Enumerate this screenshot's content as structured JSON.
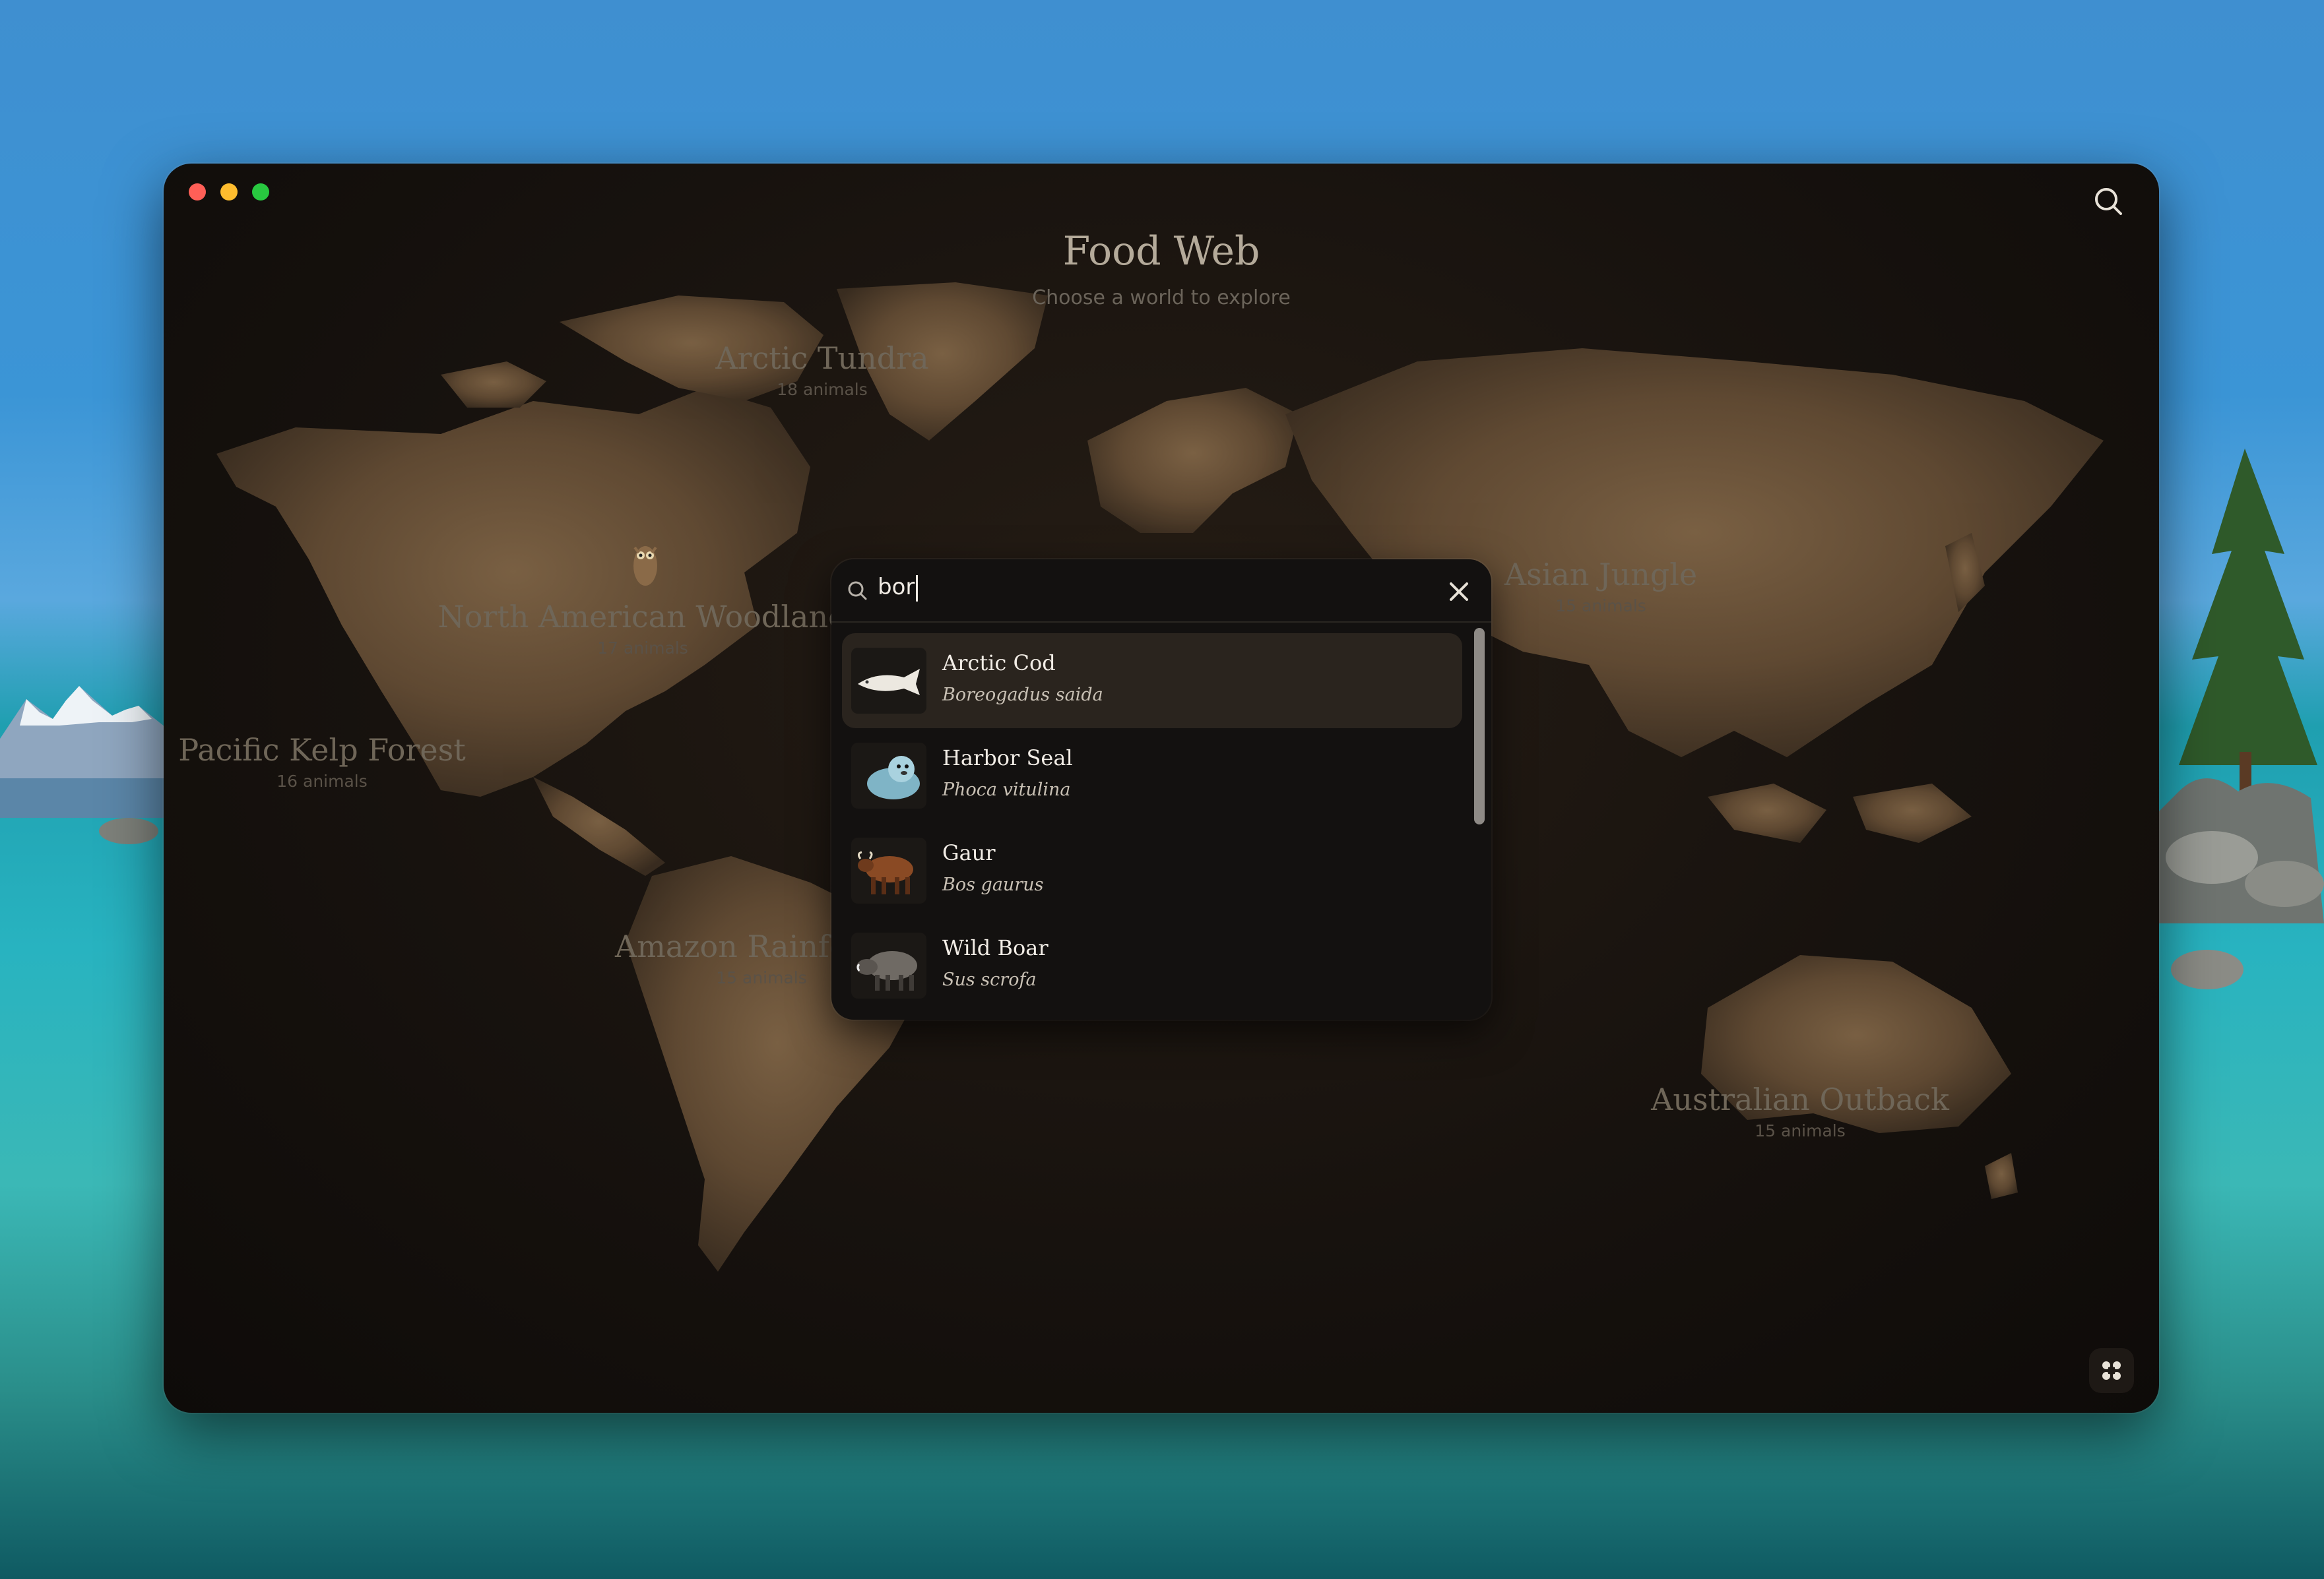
{
  "app": {
    "title": "Food Web",
    "subtitle": "Choose a world to explore"
  },
  "regions": [
    {
      "name": "Arctic Tundra",
      "count": "18 animals"
    },
    {
      "name": "North American Woodland",
      "count": "17 animals"
    },
    {
      "name": "Pacific Kelp Forest",
      "count": "16 animals"
    },
    {
      "name": "Amazon Rainforest",
      "count": "15 animals"
    },
    {
      "name": "Asian Jungle",
      "count": "15 animals"
    },
    {
      "name": "Australian Outback",
      "count": "15 animals"
    }
  ],
  "search": {
    "query": "bor",
    "results": [
      {
        "name": "Arctic Cod",
        "latin": "Boreogadus saida",
        "icon": "fish-icon",
        "selected": true
      },
      {
        "name": "Harbor Seal",
        "latin": "Phoca vitulina",
        "icon": "seal-icon",
        "selected": false
      },
      {
        "name": "Gaur",
        "latin": "Bos gaurus",
        "icon": "gaur-icon",
        "selected": false
      },
      {
        "name": "Wild Boar",
        "latin": "Sus scrofa",
        "icon": "boar-icon",
        "selected": false
      }
    ]
  },
  "colors": {
    "window_bg": "#17120e",
    "land": "#6b5238",
    "accent_text": "#b4aa9a",
    "selected_row": "#2a241e"
  }
}
